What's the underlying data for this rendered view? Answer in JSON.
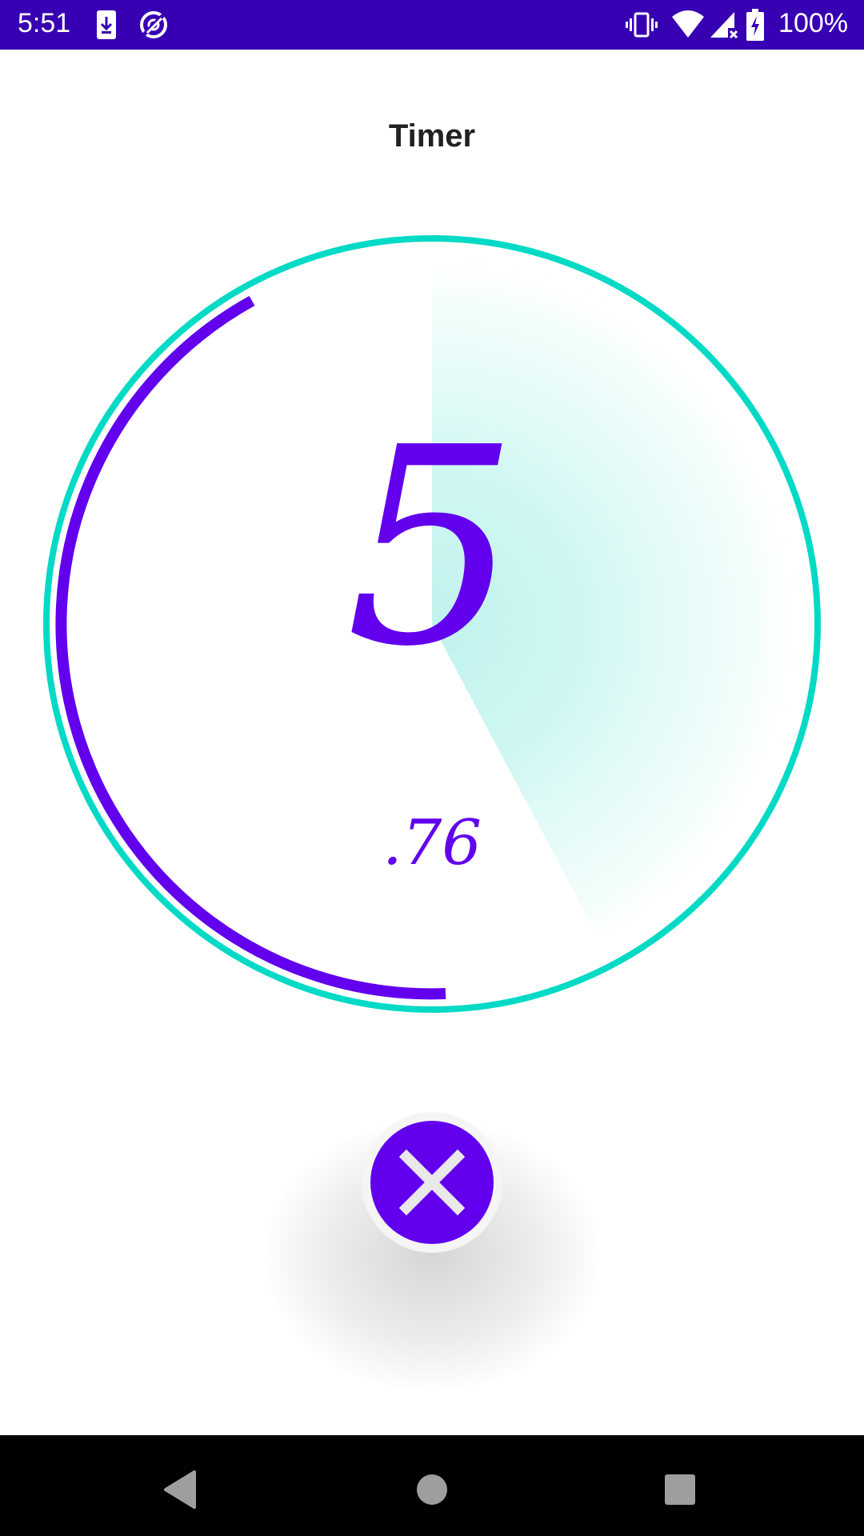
{
  "status_bar": {
    "time": "5:51",
    "battery_text": "100%",
    "icons": [
      "download-notification-icon",
      "data-saver-icon",
      "vibrate-icon",
      "wifi-icon",
      "cellular-signal-icon",
      "battery-charging-icon"
    ]
  },
  "header": {
    "title": "Timer"
  },
  "timer": {
    "seconds": "5",
    "fraction": ".76",
    "colors": {
      "accent": "#6200ee",
      "ring": "#03dac5",
      "status_bar": "#3700b3"
    }
  },
  "actions": {
    "cancel_icon": "close-icon"
  },
  "nav_bar": {
    "icons": [
      "back-icon",
      "home-icon",
      "recents-icon"
    ]
  }
}
